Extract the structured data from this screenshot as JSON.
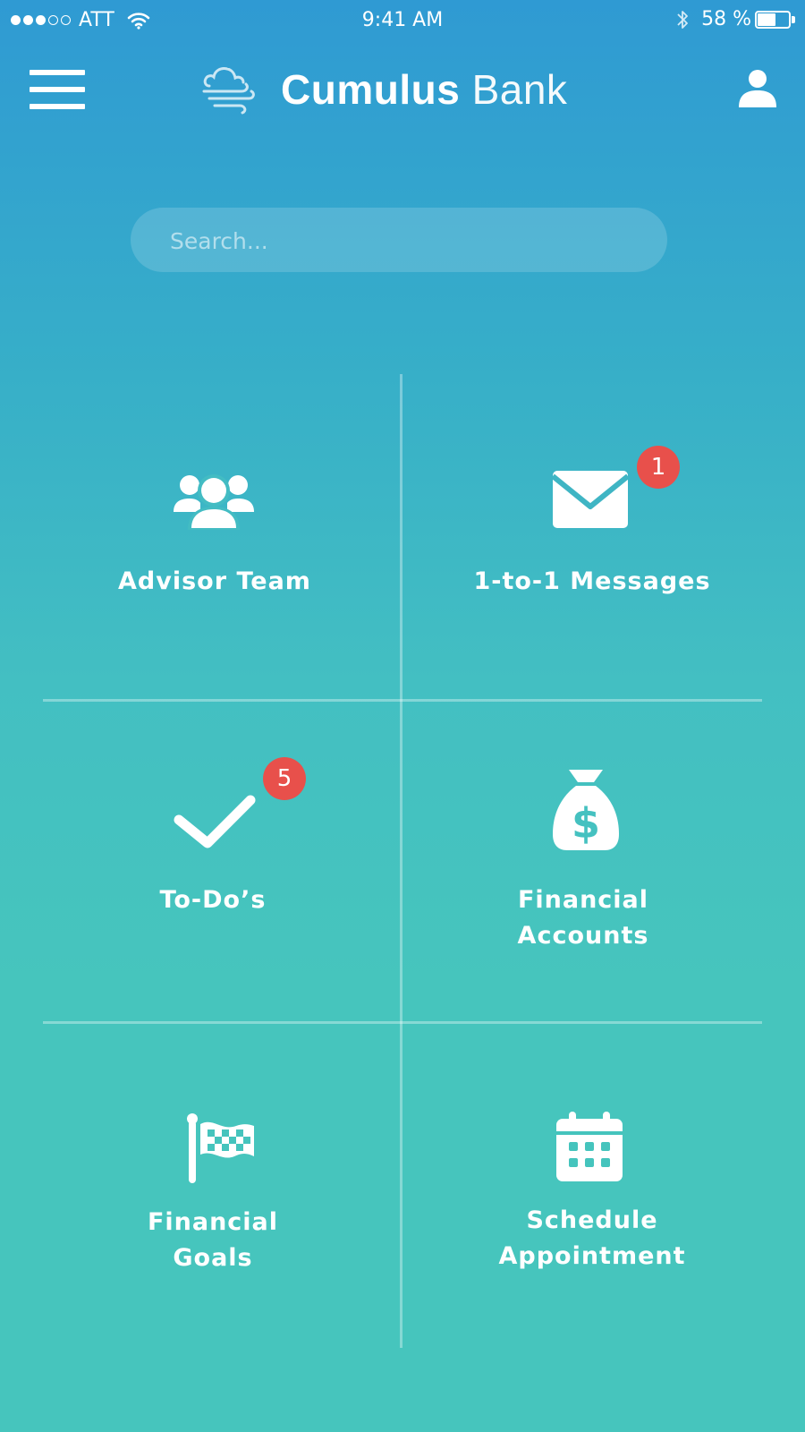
{
  "status_bar": {
    "signal_strength": 3,
    "signal_total": 5,
    "carrier": "ATT",
    "time": "9:41 AM",
    "battery_label": "58 %",
    "battery_level": 0.58
  },
  "header": {
    "brand_bold": "Cumulus",
    "brand_light": "Bank"
  },
  "search": {
    "placeholder": "Search..."
  },
  "tiles": [
    {
      "label": "Advisor Team",
      "icon": "people-icon"
    },
    {
      "label": "1-to-1 Messages",
      "icon": "envelope-icon",
      "badge": "1"
    },
    {
      "label": "To-Do’s",
      "icon": "checkmark-icon",
      "badge": "5"
    },
    {
      "label_line1": "Financial",
      "label_line2": "Accounts",
      "icon": "money-bag-icon"
    },
    {
      "label_line1": "Financial",
      "label_line2": "Goals",
      "icon": "checkered-flag-icon"
    },
    {
      "label_line1": "Schedule",
      "label_line2": "Appointment",
      "icon": "calendar-icon"
    }
  ],
  "colors": {
    "gradient_top": "#2f9ad3",
    "gradient_bottom": "#46c5bd",
    "badge": "#e8504b"
  }
}
